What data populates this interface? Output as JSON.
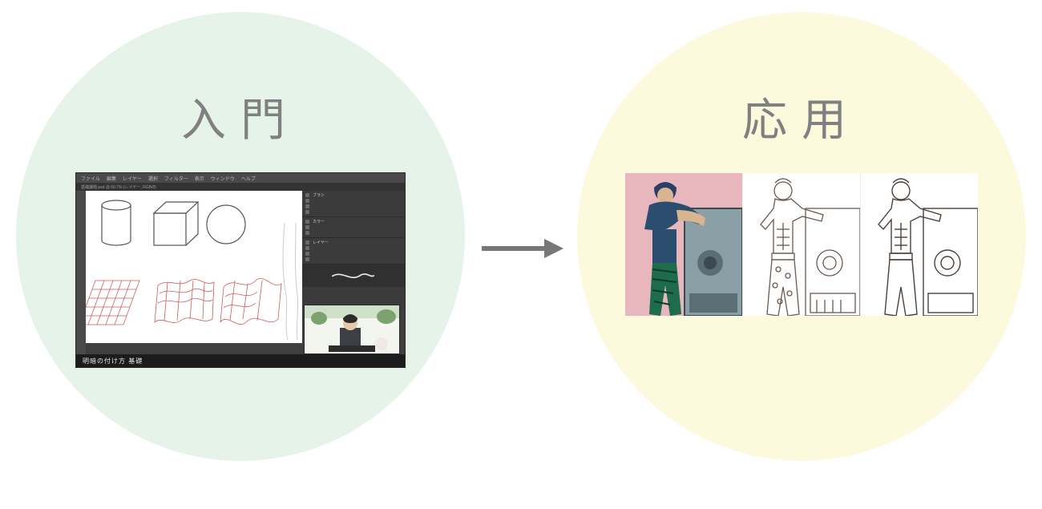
{
  "left": {
    "title": "入門",
    "editor": {
      "menu_items": [
        "ファイル",
        "編集",
        "レイヤー",
        "選択",
        "フィルター",
        "表示",
        "ウィンドウ",
        "ヘルプ"
      ],
      "document_title": "基礎課題.psd @ 66.7% (レイヤー, RGB/8)",
      "footer_text": "明暗の付け方 基礎",
      "shapes": [
        "cylinder",
        "cube",
        "sphere",
        "grid-flat",
        "grid-wave-1",
        "grid-wave-2",
        "leg-outline"
      ],
      "panel_groups": [
        {
          "label": "ブラシ"
        },
        {
          "label": "カラー"
        },
        {
          "label": "レイヤー"
        }
      ]
    }
  },
  "right": {
    "title": "応用",
    "variants": [
      {
        "name": "painted-color",
        "bg": "#e8b7bd"
      },
      {
        "name": "lineart-shaded",
        "bg": "#ffffff"
      },
      {
        "name": "lineart-clean",
        "bg": "#ffffff"
      }
    ]
  },
  "arrow": {
    "color": "#777777"
  }
}
